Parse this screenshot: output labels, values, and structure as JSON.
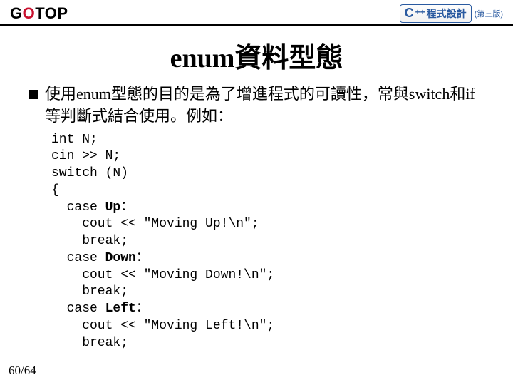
{
  "header": {
    "logo_pre": "G",
    "logo_o": "O",
    "logo_post": "TOP",
    "badge_c": "C",
    "badge_pp": "++",
    "badge_text": "程式設計",
    "badge_edition": "(第三版)"
  },
  "title": "enum資料型態",
  "bullet": "使用enum型態的目的是為了增進程式的可讀性，常與switch和if等判斷式結合使用。例如：",
  "code": {
    "l1": "int N;",
    "l2": "cin >> N;",
    "l3": "switch (N)",
    "l4": "{",
    "l5a": "  case ",
    "l5b": "Up",
    "l5c": "：",
    "l6": "    cout << \"Moving Up!\\n\";",
    "l7": "    break;",
    "l8a": "  case ",
    "l8b": "Down",
    "l8c": "：",
    "l9": "    cout << \"Moving Down!\\n\";",
    "l10": "    break;",
    "l11a": "  case ",
    "l11b": "Left",
    "l11c": "：",
    "l12": "    cout << \"Moving Left!\\n\";",
    "l13": "    break;"
  },
  "page": "60/64"
}
